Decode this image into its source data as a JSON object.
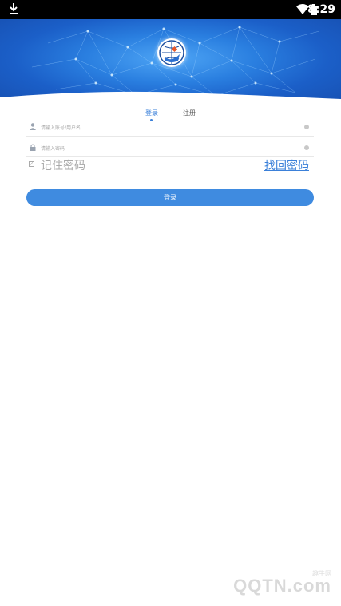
{
  "status_bar": {
    "time": "8:29",
    "icons": [
      "download-icon",
      "wifi-icon",
      "battery-icon"
    ]
  },
  "banner": {
    "logo": "globe-logo"
  },
  "tabs": [
    {
      "label": "登录",
      "active": true
    },
    {
      "label": "注册",
      "active": false
    }
  ],
  "form": {
    "account_placeholder": "请输入账号/用户名",
    "password_placeholder": "请输入密码",
    "remember_label": "记住密码",
    "remember_checked": true,
    "forgot_label": "找回密码",
    "submit_label": "登录"
  },
  "watermark": {
    "top": "趣牛网",
    "text": "QQTN.com"
  },
  "colors": {
    "accent": "#3b80d9",
    "button": "#3f8be0",
    "banner": "#1b5fc8"
  }
}
